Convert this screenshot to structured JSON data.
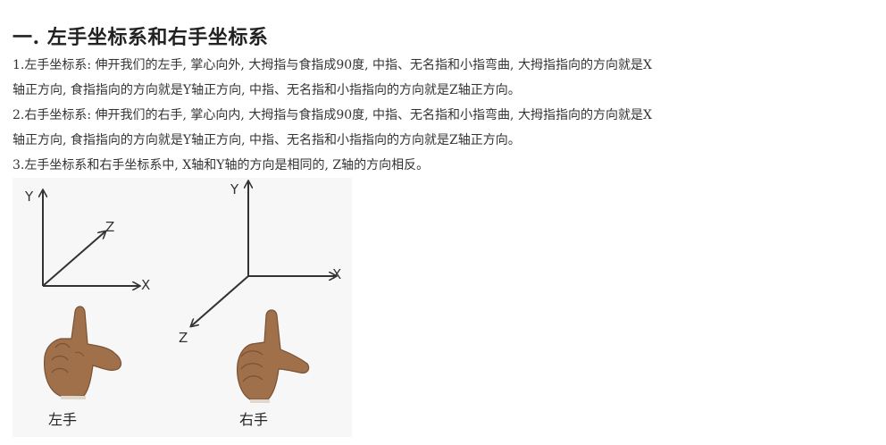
{
  "heading": "一. 左手坐标系和右手坐标系",
  "paragraphs": {
    "p1_line1": "1.左手坐标系: 伸开我们的左手, 掌心向外, 大拇指与食指成90度, 中指、无名指和小指弯曲, 大拇指指向的方向就是X",
    "p1_line2": "轴正方向, 食指指向的方向就是Y轴正方向, 中指、无名指和小指指向的方向就是Z轴正方向。",
    "p2_line1": "2.右手坐标系: 伸开我们的右手, 掌心向内, 大拇指与食指成90度, 中指、无名指和小指弯曲, 大拇指指向的方向就是X",
    "p2_line2": "轴正方向, 食指指向的方向就是Y轴正方向, 中指、无名指和小指指向的方向就是Z轴正方向。",
    "p3_line1": "3.左手坐标系和右手坐标系中, X轴和Y轴的方向是相同的, Z轴的方向相反。"
  },
  "figure": {
    "left": {
      "y_label": "Y",
      "z_label": "Z",
      "x_label": "X",
      "caption": "左手"
    },
    "right": {
      "y_label": "Y",
      "z_label": "Z",
      "x_label": "X",
      "caption": "右手"
    },
    "colors": {
      "skin": "#a0704a",
      "skin_shadow": "#7a5234",
      "axis": "#333333"
    }
  }
}
